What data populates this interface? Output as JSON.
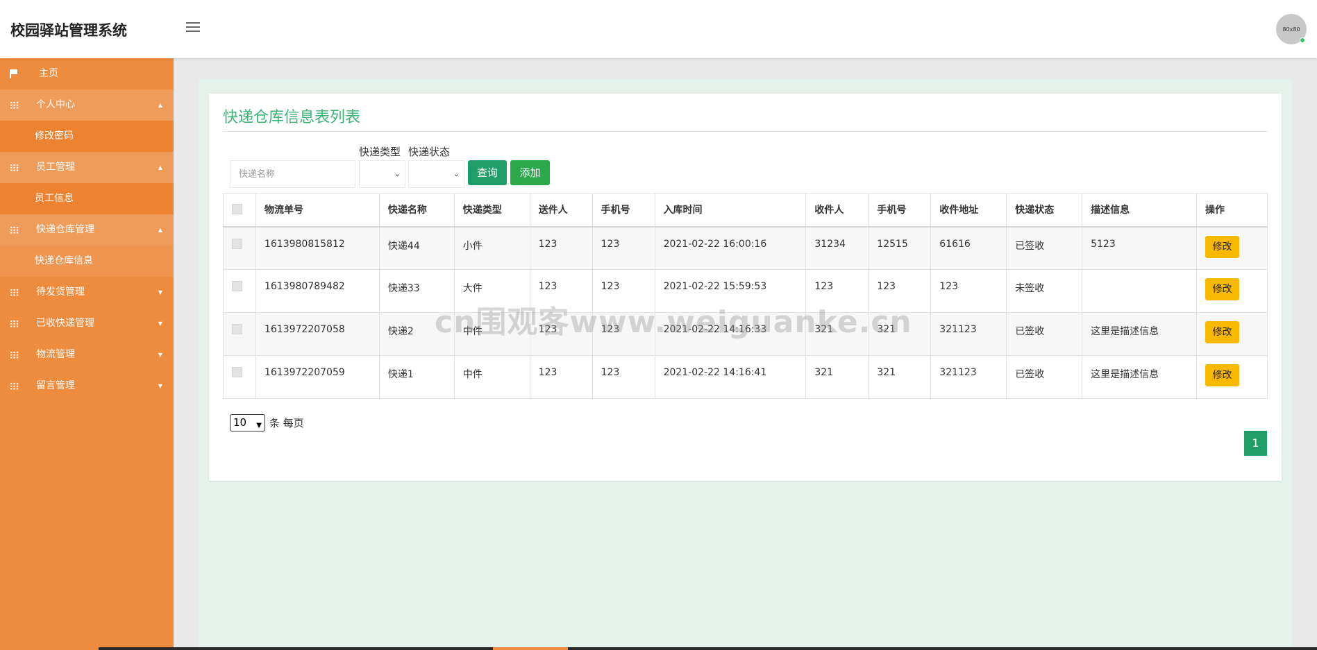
{
  "app": {
    "title": "校园驿站管理系统",
    "avatar_text": "80x80"
  },
  "sidebar": {
    "items": [
      {
        "label": "主页",
        "icon": "flag-icon",
        "open": false,
        "subs": []
      },
      {
        "label": "个人中心",
        "icon": "grid-icon",
        "open": true,
        "subs": [
          "修改密码"
        ]
      },
      {
        "label": "员工管理",
        "icon": "grid-icon",
        "open": true,
        "subs": [
          "员工信息"
        ]
      },
      {
        "label": "快递仓库管理",
        "icon": "grid-icon",
        "open": true,
        "subs": [
          "快递仓库信息"
        ]
      },
      {
        "label": "待发货管理",
        "icon": "grid-icon",
        "open": false,
        "subs": []
      },
      {
        "label": "已收快递管理",
        "icon": "grid-icon",
        "open": false,
        "subs": []
      },
      {
        "label": "物流管理",
        "icon": "grid-icon",
        "open": false,
        "subs": []
      },
      {
        "label": "留言管理",
        "icon": "grid-icon",
        "open": false,
        "subs": []
      }
    ]
  },
  "main": {
    "title": "快递仓库信息表列表",
    "search": {
      "placeholder": "快递名称",
      "type_label": "快递类型",
      "status_label": "快递状态",
      "query_label": "查询",
      "add_label": "添加"
    },
    "table": {
      "headers": [
        "物流单号",
        "快递名称",
        "快递类型",
        "送件人",
        "手机号",
        "入库时间",
        "收件人",
        "手机号",
        "收件地址",
        "快递状态",
        "描述信息",
        "操作"
      ],
      "rows": [
        [
          "1613980815812",
          "快递44",
          "小件",
          "123",
          "123",
          "2021-02-22 16:00:16",
          "31234",
          "12515",
          "61616",
          "已签收",
          "5123"
        ],
        [
          "1613980789482",
          "快递33",
          "大件",
          "123",
          "123",
          "2021-02-22 15:59:53",
          "123",
          "123",
          "123",
          "未签收",
          ""
        ],
        [
          "1613972207058",
          "快递2",
          "中件",
          "123",
          "123",
          "2021-02-22 14:16:33",
          "321",
          "321",
          "321123",
          "已签收",
          "这里是描述信息"
        ],
        [
          "1613972207059",
          "快递1",
          "中件",
          "123",
          "123",
          "2021-02-22 14:16:41",
          "321",
          "321",
          "321123",
          "已签收",
          "这里是描述信息"
        ]
      ],
      "edit_label": "修改"
    },
    "pager": {
      "per_page_value": "10",
      "per_page_text": "条 每页",
      "current_page": "1"
    }
  },
  "watermark": "cn围观客www.weiguanke.cn",
  "colors": {
    "sidebar": "#ef8b3c",
    "accent_green": "#1f9e6a",
    "title_green": "#3db374",
    "edit_yellow": "#f8b900"
  }
}
